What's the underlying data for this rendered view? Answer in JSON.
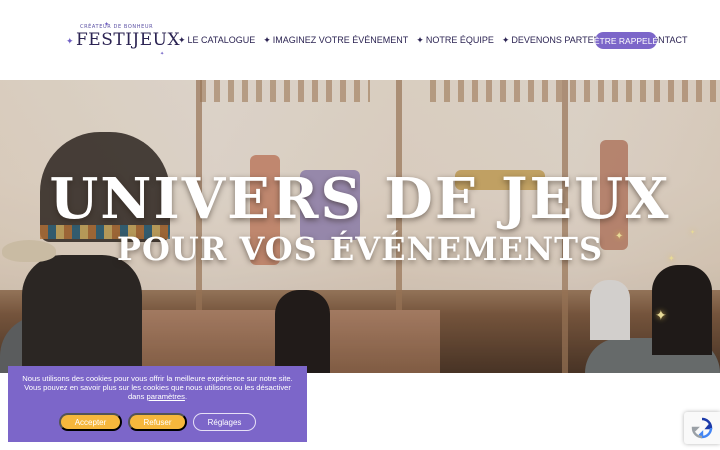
{
  "logo": {
    "tagline": "CRÉATEUR DE BONHEUR",
    "name": "FESTIJEUX"
  },
  "nav": {
    "items": [
      {
        "label": "LE CATALOGUE"
      },
      {
        "label": "IMAGINEZ VOTRE ÉVÉNEMENT"
      },
      {
        "label": "NOTRE ÉQUIPE"
      },
      {
        "label": "DEVENONS PARTENAIRES"
      },
      {
        "label": "CONTACT"
      }
    ],
    "star_glyph": "✦",
    "cta_label": "ÊTRE RAPPELÉ"
  },
  "hero": {
    "title": "UNIVERS DE JEUX",
    "subtitle": "POUR VOS ÉVÉNEMENTS"
  },
  "cookie": {
    "text_before_link": "Nous utilisons des cookies pour vous offrir la meilleure expérience sur notre site. Vous pouvez en savoir plus sur les cookies que nous utilisons ou les désactiver dans ",
    "link_text": "paramètres",
    "text_after_link": ".",
    "accept_label": "Accepter",
    "refuse_label": "Refuser",
    "settings_label": "Réglages"
  },
  "colors": {
    "brand_purple": "#7c66c9",
    "accent_yellow": "#f6b73c",
    "text_dark": "#2b2352"
  },
  "icons": {
    "recaptcha": "recaptcha-icon",
    "nav_bullet": "star-icon"
  }
}
